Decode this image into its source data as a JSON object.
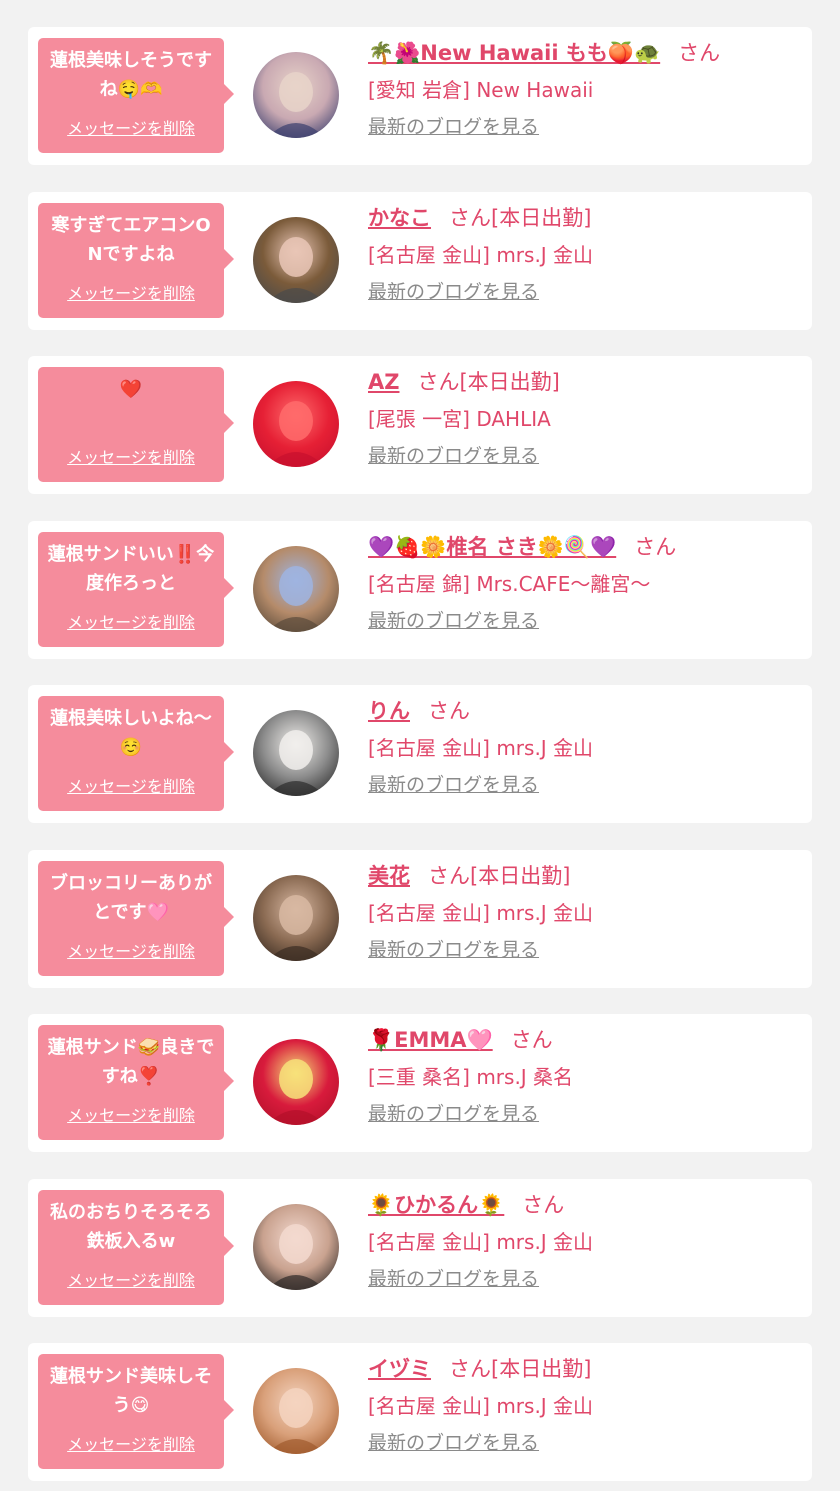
{
  "colors": {
    "page_bg": "#f2f2f2",
    "card_bg": "#ffffff",
    "bubble_bg": "#f58c9c",
    "accent": "#e0476a",
    "link_gray": "#8a8a8a"
  },
  "delete_label": "メッセージを削除",
  "blog_label": "最新のブログを見る",
  "honorific": "さん",
  "items": [
    {
      "message": "蓮根美味しそうですね🤤🫶",
      "name": "🌴🌺New Hawaii もも🍑🐢",
      "honorific": "さん",
      "shop": "[愛知 岩倉] New Hawaii",
      "avatar_colors": [
        "#3b3f6e",
        "#c9a9b2",
        "#e8d3c9"
      ]
    },
    {
      "message": "寒すぎてエアコンONですよね",
      "name": "かなこ",
      "honorific": "さん[本日出勤]",
      "shop": "[名古屋 金山] mrs.J 金山",
      "avatar_colors": [
        "#4a4a4a",
        "#7b5b3a",
        "#e9c6b6"
      ]
    },
    {
      "message": "❤️",
      "name": "AZ",
      "honorific": "さん[本日出勤]",
      "shop": "[尾張 一宮] DAHLIA",
      "avatar_colors": [
        "#c8102e",
        "#e62035",
        "#ff6b6b"
      ]
    },
    {
      "message": "蓮根サンドいい‼️今度作ろっと",
      "name": "💜🍓🌼椎名 さき🌼🍭💜",
      "honorific": "さん",
      "shop": "[名古屋 錦] Mrs.CAFE～離宮～",
      "avatar_colors": [
        "#5a4a3a",
        "#b58b6a",
        "#9fb4e0"
      ]
    },
    {
      "message": "蓮根美味しいよね～☺️",
      "name": "りん",
      "honorific": "さん",
      "shop": "[名古屋 金山] mrs.J 金山",
      "avatar_colors": [
        "#2c2c2c",
        "#8c8c8c",
        "#f1efec"
      ]
    },
    {
      "message": "ブロッコリーありがとです🩷",
      "name": "美花",
      "honorific": "さん[本日出勤]",
      "shop": "[名古屋 金山] mrs.J 金山",
      "avatar_colors": [
        "#3a2c22",
        "#8a6a52",
        "#d8b8a2"
      ]
    },
    {
      "message": "蓮根サンド🥪良きですね❣️",
      "name": "🌹EMMA🩷",
      "honorific": "さん",
      "shop": "[三重 桑名] mrs.J 桑名",
      "avatar_colors": [
        "#b3102a",
        "#d81b3c",
        "#f7e27a"
      ]
    },
    {
      "message": "私のおちりそろそろ鉄板入るw",
      "name": "🌻ひかるん🌻",
      "honorific": "さん",
      "shop": "[名古屋 金山] mrs.J 金山",
      "avatar_colors": [
        "#2f2a28",
        "#c9a28f",
        "#f3d9cf"
      ]
    },
    {
      "message": "蓮根サンド美味しそう😋",
      "name": "イヅミ",
      "honorific": "さん[本日出勤]",
      "shop": "[名古屋 金山] mrs.J 金山",
      "avatar_colors": [
        "#a05a2c",
        "#d9a07a",
        "#f4d4c0"
      ]
    }
  ]
}
